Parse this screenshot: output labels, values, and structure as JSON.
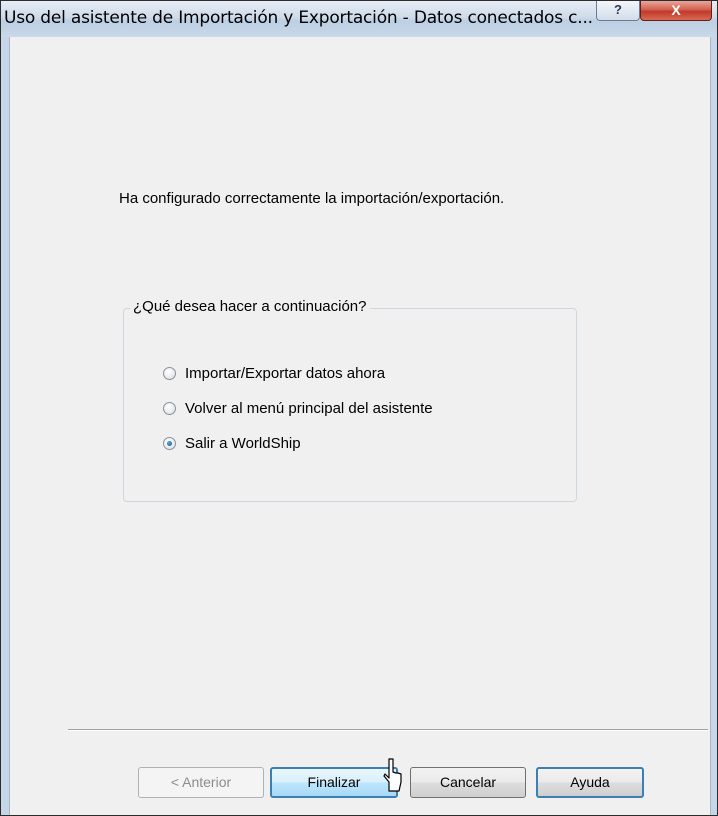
{
  "window": {
    "title": "Uso del asistente de Importación y Exportación - Datos conectados c...",
    "help_glyph": "?",
    "close_glyph": "X"
  },
  "content": {
    "message": "Ha configurado correctamente la importación/exportación."
  },
  "group": {
    "legend": "¿Qué desea hacer a continuación?",
    "options": [
      {
        "label": "Importar/Exportar datos ahora",
        "checked": false
      },
      {
        "label": "Volver al menú principal del asistente",
        "checked": false
      },
      {
        "label": "Salir a WorldShip",
        "checked": true
      }
    ]
  },
  "buttons": {
    "back": "< Anterior",
    "finish": "Finalizar",
    "cancel": "Cancelar",
    "help": "Ayuda"
  },
  "colors": {
    "accent": "#3c7fb1",
    "close": "#c0392b"
  }
}
